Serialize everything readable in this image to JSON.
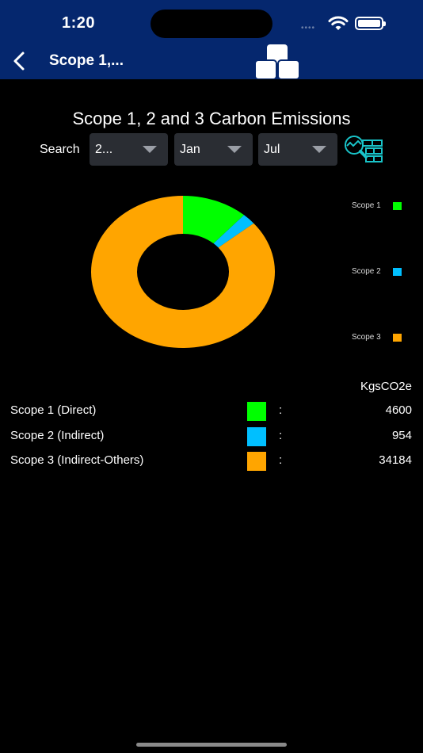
{
  "status_bar": {
    "time": "1:20"
  },
  "nav": {
    "title": "Scope 1,..."
  },
  "filters": {
    "search_label": "Search",
    "year": "2...",
    "from_month": "Jan",
    "to_month": "Jul"
  },
  "chart_data": {
    "type": "pie",
    "title": "Scope 1, 2 and 3 Carbon Emissions",
    "donut": true,
    "legend_placement": "right",
    "series": [
      {
        "name": "Scope 1",
        "value": 4600,
        "color": "#00ff00"
      },
      {
        "name": "Scope 2",
        "value": 954,
        "color": "#00bfff"
      },
      {
        "name": "Scope 3",
        "value": 34184,
        "color": "#ffa500"
      }
    ]
  },
  "table": {
    "units": "KgsCO2e",
    "separator": ":",
    "rows": [
      {
        "label": "Scope 1 (Direct)",
        "value": "4600",
        "color": "#00ff00"
      },
      {
        "label": "Scope 2 (Indirect)",
        "value": "954",
        "color": "#00bfff"
      },
      {
        "label": "Scope 3 (Indirect-Others)",
        "value": "34184",
        "color": "#ffa500"
      }
    ]
  },
  "icons": {
    "back": "chevron-left-icon",
    "logo": "stacked-cubes-logo",
    "filter": "search-report-icon"
  },
  "colors": {
    "nav_background": "#05276e",
    "filter_accent": "#19c3c8"
  }
}
